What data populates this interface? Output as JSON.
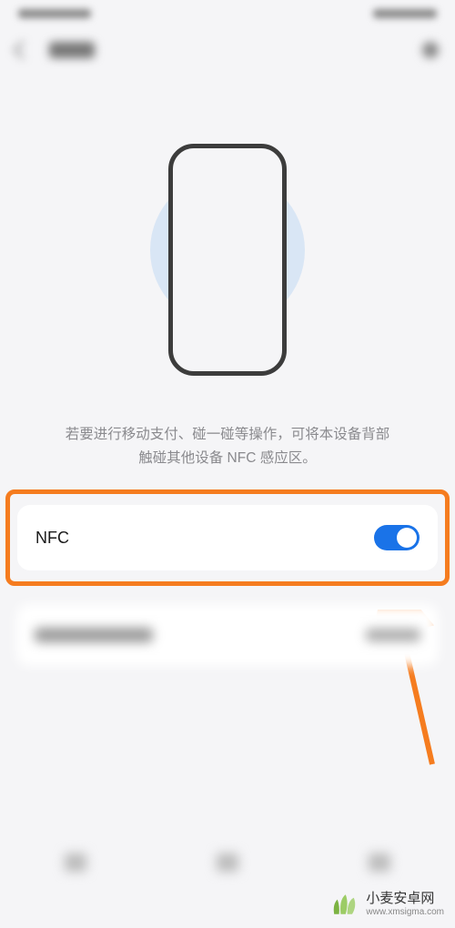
{
  "description": {
    "line1": "若要进行移动支付、碰一碰等操作，可将本设备背部",
    "line2": "触碰其他设备 NFC 感应区。"
  },
  "nfc": {
    "label": "NFC",
    "enabled": true
  },
  "watermark": {
    "name": "小麦安卓网",
    "url": "www.xmsigma.com"
  }
}
